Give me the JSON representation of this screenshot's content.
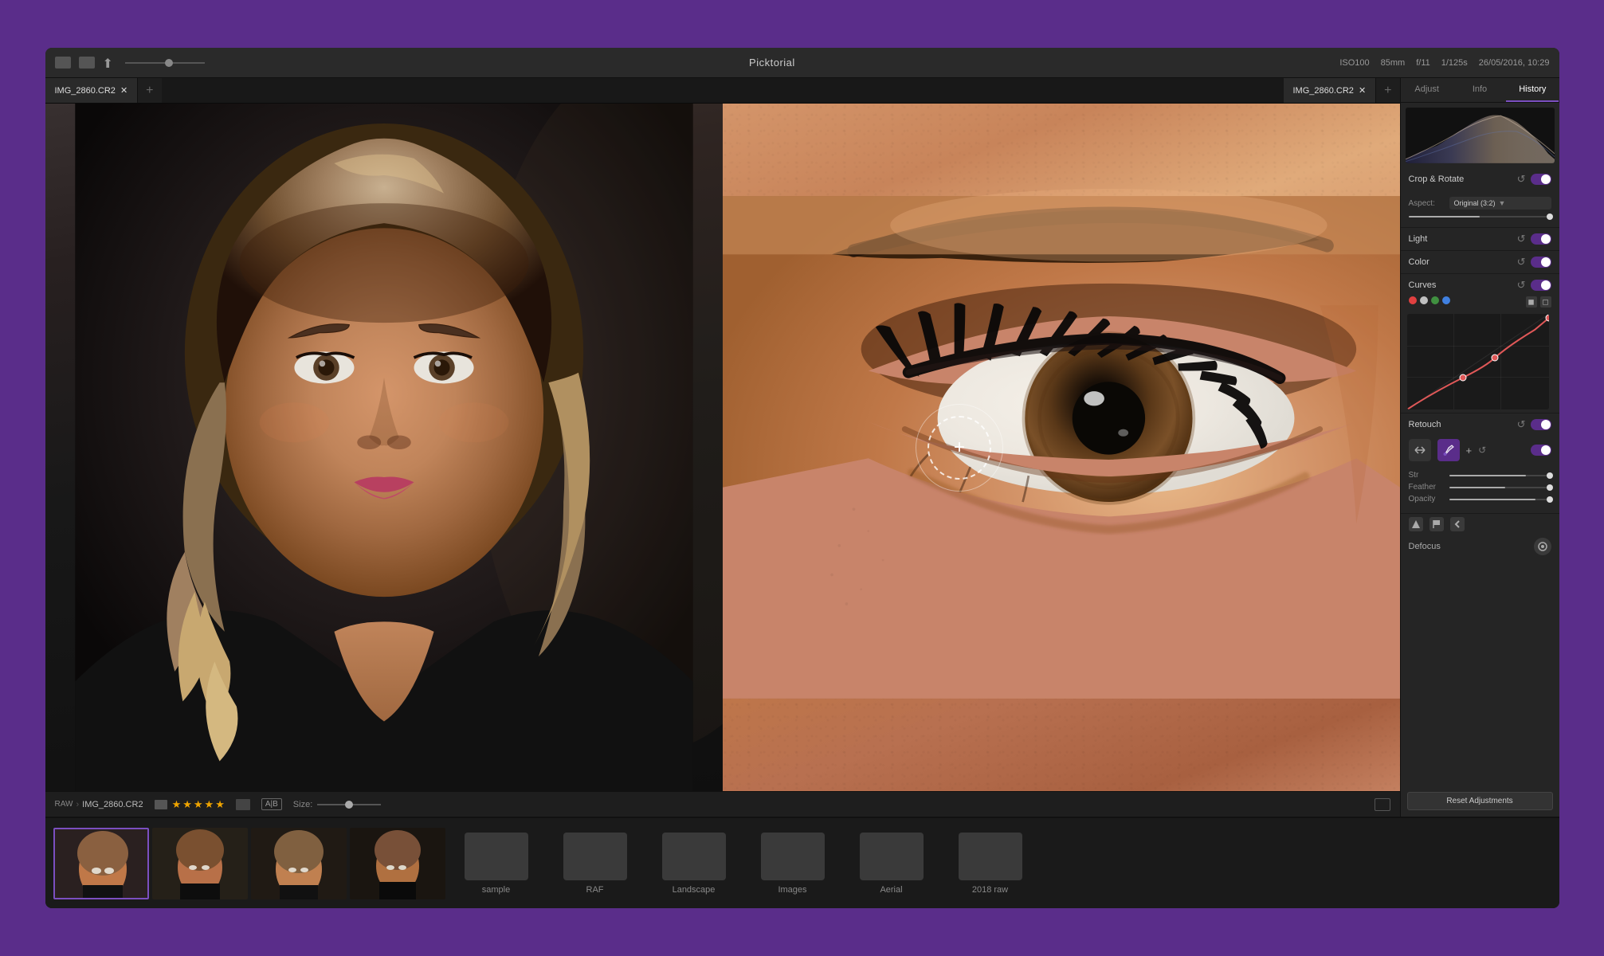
{
  "app": {
    "title": "Picktorial",
    "datetime": "26/05/2016, 10:29",
    "camera_info": {
      "iso": "ISO100",
      "focal": "85mm",
      "aperture": "f/11",
      "shutter": "1/125s"
    }
  },
  "tabs": {
    "left_tab1": "IMG_2860.CR2",
    "right_tab1": "IMG_2860.CR2",
    "add_label": "+"
  },
  "sidebar_tabs": {
    "adjust": "Adjust",
    "info": "Info",
    "history": "History"
  },
  "sections": {
    "crop": {
      "label": "Crop & Rotate",
      "aspect_label": "Aspect:",
      "aspect_value": "Original (3:2)"
    },
    "light": {
      "label": "Light"
    },
    "color": {
      "label": "Color"
    },
    "curves": {
      "label": "Curves"
    },
    "retouch": {
      "label": "Retouch"
    },
    "defocus": {
      "label": "Defocus"
    }
  },
  "status_bar": {
    "raw_label": "RAW",
    "filename": "IMG_2860.CR2",
    "size_label": "Size:",
    "ab_label": "A|B"
  },
  "filmstrip": {
    "folders": [
      "sample",
      "RAF",
      "Landscape",
      "Images",
      "Aerial",
      "2018 raw"
    ]
  },
  "buttons": {
    "reset_adjustments": "Reset Adjustments"
  },
  "curves": {
    "dots": [
      {
        "color": "#e04040"
      },
      {
        "color": "#c0c0c0"
      },
      {
        "color": "#409040"
      },
      {
        "color": "#4080e0"
      }
    ]
  },
  "retouch_tools": {
    "heal_label": "heal",
    "paint_label": "paint",
    "add_label": "+",
    "reset_label": "↺"
  }
}
